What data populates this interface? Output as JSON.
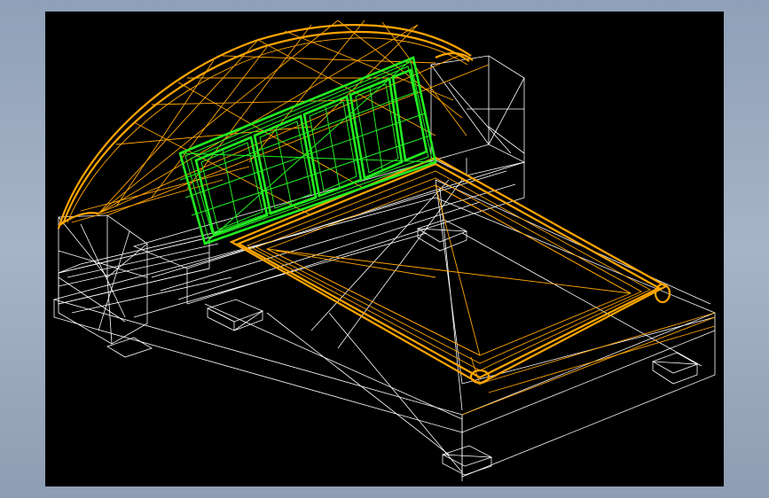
{
  "screen": {
    "frame_color": "#9aa9bf",
    "viewport_background": "#000000"
  },
  "model": {
    "render_mode": "wireframe",
    "colors": {
      "base": "#ffffff",
      "arch_and_tray": "#ffa500",
      "panel": "#22ee22"
    }
  }
}
